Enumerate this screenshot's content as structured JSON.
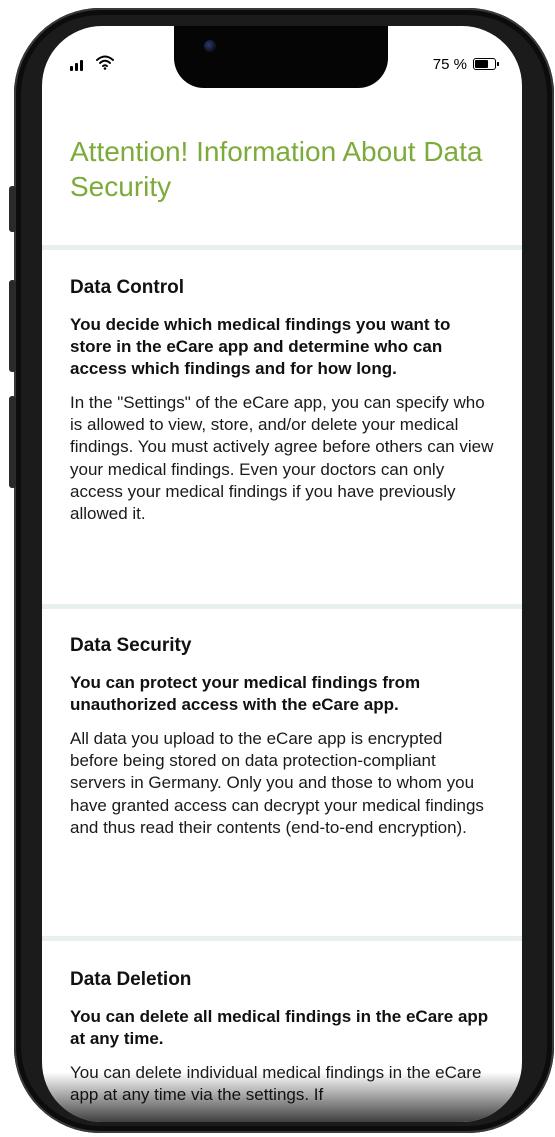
{
  "status_bar": {
    "battery_percent": "75 %",
    "icons": [
      "signal-icon",
      "wifi-icon",
      "battery-icon"
    ]
  },
  "header": {
    "title": "Attention! Information About Data Security"
  },
  "sections": [
    {
      "heading": "Data Control",
      "lead": "You decide which medical findings you want to store in the eCare app and determine who can access which findings and for how long.",
      "body": "In the \"Settings\" of the eCare app, you can specify who is allowed to view, store, and/or delete your medical findings. You must actively agree before others can view your medical findings. Even your doctors can only access your medical findings if you have previously allowed it."
    },
    {
      "heading": "Data Security",
      "lead": "You can protect your medical findings from unauthorized access with the eCare app.",
      "body": "All data you upload to the eCare app is encrypted before being stored on data protection-compliant servers in Germany. Only you and those to whom you have granted access can decrypt your medical findings and thus read their contents (end-to-end encryption)."
    },
    {
      "heading": "Data Deletion",
      "lead": "You can delete all medical findings in the eCare app at any time.",
      "body": "You can delete individual medical findings in the eCare app at any time via the settings. If"
    }
  ],
  "colors": {
    "title_green": "#7cab3a",
    "divider": "#e8efef",
    "frame": "#1b1b1c"
  }
}
